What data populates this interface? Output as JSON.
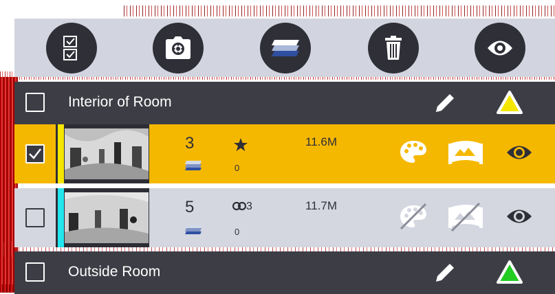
{
  "colors": {
    "toolbar_bg": "#d2d5df",
    "header_bg": "#3d3d46",
    "selected_row_bg": "#f5b800",
    "unselected_row_bg": "#d4d6e0",
    "interior_triangle": "#f5e600",
    "outside_triangle": "#22cc22"
  },
  "toolbar": {
    "buttons": [
      {
        "icon": "select-all-checklist-icon"
      },
      {
        "icon": "camera-icon"
      },
      {
        "icon": "layers-icon"
      },
      {
        "icon": "trash-icon"
      },
      {
        "icon": "eye-icon"
      }
    ]
  },
  "groups": [
    {
      "name": "Interior of Room",
      "checked": false,
      "triangle_color": "#f5e600",
      "scans": [
        {
          "checked": true,
          "color_bar": "#f5e600",
          "count": "3",
          "stat_icon": "star-icon",
          "stat_text": "",
          "sub_count": "0",
          "size": "11.6M",
          "palette_enabled": true,
          "pano_enabled": true
        },
        {
          "checked": false,
          "color_bar": "#22e5ee",
          "count": "5",
          "stat_icon": "link-icon",
          "stat_text": "3",
          "sub_count": "0",
          "size": "11.7M",
          "palette_enabled": false,
          "pano_enabled": false
        }
      ]
    },
    {
      "name": "Outside Room",
      "checked": false,
      "triangle_color": "#22cc22",
      "scans": []
    }
  ]
}
